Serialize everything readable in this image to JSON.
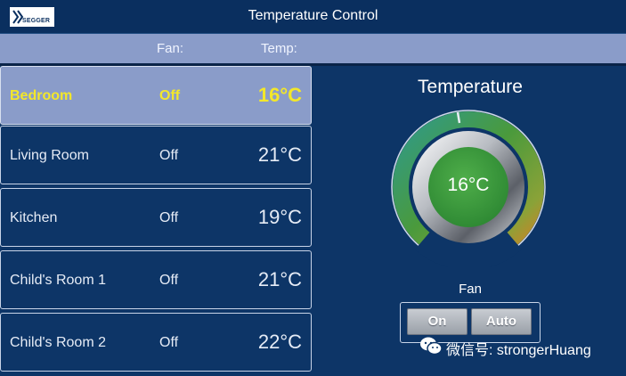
{
  "app": {
    "logo_text": "SEGGER",
    "title": "Temperature Control"
  },
  "columns": {
    "fan": "Fan:",
    "temp": "Temp:"
  },
  "rooms": [
    {
      "name": "Bedroom",
      "fan": "Off",
      "temp": "16°C",
      "selected": true
    },
    {
      "name": "Living Room",
      "fan": "Off",
      "temp": "21°C",
      "selected": false
    },
    {
      "name": "Kitchen",
      "fan": "Off",
      "temp": "19°C",
      "selected": false
    },
    {
      "name": "Child's Room 1",
      "fan": "Off",
      "temp": "21°C",
      "selected": false
    },
    {
      "name": "Child's Room 2",
      "fan": "Off",
      "temp": "22°C",
      "selected": false
    }
  ],
  "panel": {
    "title": "Temperature",
    "dial_value": "16°C",
    "fan_label": "Fan",
    "fan_buttons": {
      "on": "On",
      "auto": "Auto"
    }
  },
  "watermark": {
    "text": "微信号: strongerHuang",
    "icon": "wechat-icon"
  },
  "colors": {
    "background": "#0d3567",
    "header": "#8a9cc9",
    "selected_text": "#f3e72a",
    "dial_center": "#3d9a3d"
  }
}
